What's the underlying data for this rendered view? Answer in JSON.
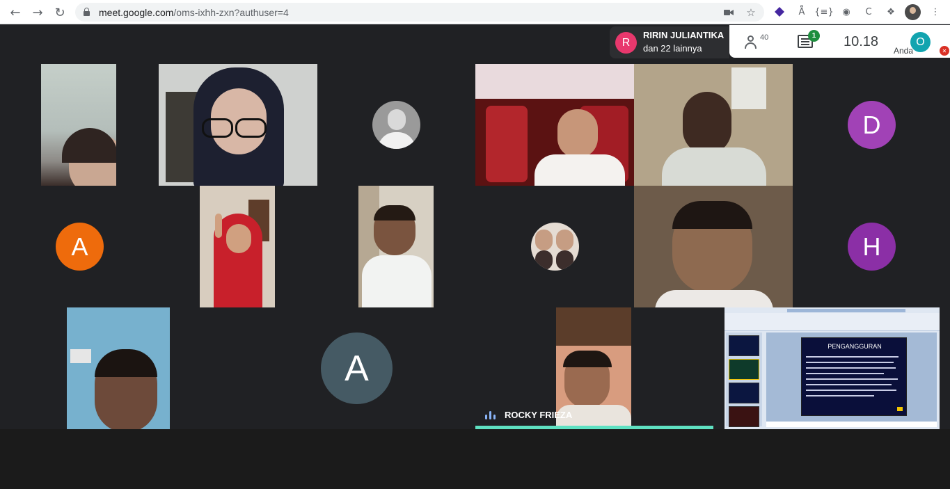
{
  "browser": {
    "url_host": "meet.google.com",
    "url_path": "/oms-ixhh-zxn?authuser=4",
    "back_icon": "arrow-left",
    "forward_icon": "arrow-right",
    "reload_icon": "reload",
    "extensions": [
      "camera-icon",
      "star-icon",
      "purple-extension-icon",
      "text-extension-icon",
      "code-extension-icon",
      "shield-extension-icon",
      "c-extension-icon",
      "puzzle-icon",
      "profile-avatar",
      "menu-kebab-icon"
    ]
  },
  "meet": {
    "presenter": {
      "initial": "R",
      "name": "RIRIN JULIANTIKA",
      "subtitle": "dan 22 lainnya",
      "color": "#e8386d"
    },
    "participants_count": "40",
    "chat_badge": "1",
    "time": "10.18",
    "self": {
      "label": "Anda",
      "initial": "O",
      "color": "#12a4af"
    }
  },
  "tiles": [
    {
      "type": "letter",
      "initial": "D",
      "color": "#a142b6"
    },
    {
      "type": "letter",
      "initial": "A",
      "color": "#ee6b0c"
    },
    {
      "type": "letter",
      "initial": "H",
      "color": "#8b2fa6"
    },
    {
      "type": "letter",
      "initial": "A",
      "color": "#455a64"
    }
  ],
  "speaker": {
    "name": "ROCKY FRIEZA",
    "accent": "#5fe1c2"
  },
  "screen_share": {
    "slide_title": "PENGANGGURAN"
  }
}
